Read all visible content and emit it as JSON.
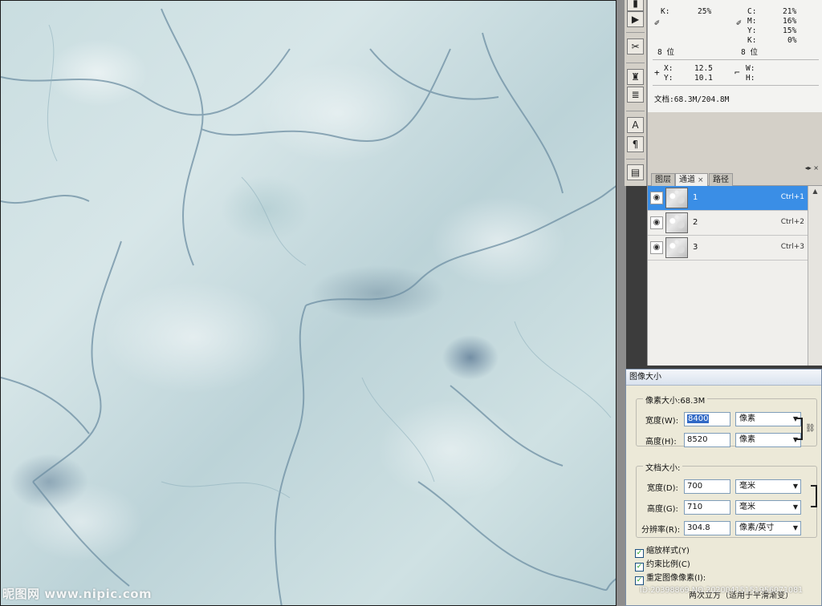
{
  "canvas": {
    "watermark": "昵图网 www.nipic.com"
  },
  "tools": {
    "icons": [
      "play-icon",
      "brush-icon",
      "stamp-icon",
      "history-brush-icon",
      "type-icon",
      "paragraph-icon",
      "layer-comps-icon"
    ]
  },
  "info": {
    "k_label": "K:",
    "k_value": "25%",
    "c_label": "C:",
    "c_value": "21%",
    "m_label": "M:",
    "m_value": "16%",
    "y_label": "Y:",
    "y_value": "15%",
    "k2_label": "K:",
    "k2_value": "0%",
    "bits_left": "8 位",
    "bits_right": "8 位",
    "x_label": "X:",
    "x_value": "12.5",
    "y2_label": "Y:",
    "y2_value": "10.1",
    "w_label": "W:",
    "h_label": "H:",
    "doc": "文档:68.3M/204.8M"
  },
  "channels": {
    "tabs": [
      {
        "label": "图层"
      },
      {
        "label": "通道",
        "close": "×"
      },
      {
        "label": "路径"
      }
    ],
    "panel_controls": "◂▸  ×",
    "rows": [
      {
        "name": "1",
        "shortcut": "Ctrl+1"
      },
      {
        "name": "2",
        "shortcut": "Ctrl+2"
      },
      {
        "name": "3",
        "shortcut": "Ctrl+3"
      }
    ]
  },
  "dialog": {
    "title": "图像大小",
    "pixel_group": "像素大小:68.3M",
    "width_label": "宽度(W):",
    "width_value": "8400",
    "width_unit": "像素",
    "height_label": "高度(H):",
    "height_value": "8520",
    "height_unit": "像素",
    "doc_group": "文档大小:",
    "doc_width_label": "宽度(D):",
    "doc_width_value": "700",
    "doc_width_unit": "毫米",
    "doc_height_label": "高度(G):",
    "doc_height_value": "710",
    "doc_height_unit": "毫米",
    "res_label": "分辨率(R):",
    "res_value": "304.8",
    "res_unit": "像素/英寸",
    "scale_styles": "缩放样式(Y)",
    "constrain": "约束比例(C)",
    "resample": "重定图像像素(I):",
    "resample_method": "两次立方（适用于平滑渐变）"
  },
  "overlay_id": "ID:20398869 NO:20200415151956071081"
}
